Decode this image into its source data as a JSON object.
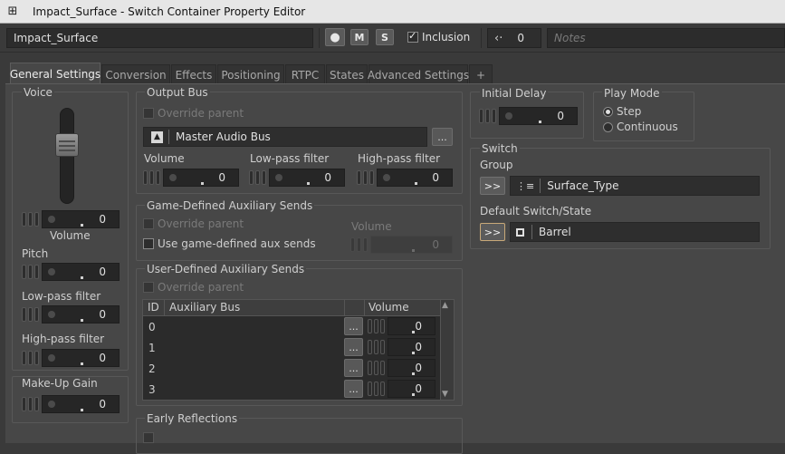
{
  "window": {
    "title": "Impact_Surface - Switch Container Property Editor",
    "icon": "switch-container-icon"
  },
  "toolbar": {
    "name_value": "Impact_Surface",
    "color_icon": "palette-icon",
    "mute_label": "M",
    "solo_label": "S",
    "inclusion_label": "Inclusion",
    "inclusion_checked": true,
    "share_icon": "share-icon",
    "share_count": "0",
    "notes_placeholder": "Notes"
  },
  "tabs": [
    {
      "label": "General Settings",
      "active": true
    },
    {
      "label": "Conversion"
    },
    {
      "label": "Effects"
    },
    {
      "label": "Positioning"
    },
    {
      "label": "RTPC"
    },
    {
      "label": "States"
    },
    {
      "label": "Advanced Settings"
    },
    {
      "label": "+"
    }
  ],
  "voice": {
    "title": "Voice",
    "volume_value": "0",
    "volume_label": "Volume",
    "pitch_label": "Pitch",
    "pitch_value": "0",
    "lpf_label": "Low-pass filter",
    "lpf_value": "0",
    "hpf_label": "High-pass filter",
    "hpf_value": "0"
  },
  "makeup": {
    "title": "Make-Up Gain",
    "value": "0"
  },
  "output_bus": {
    "title": "Output Bus",
    "override_label": "Override parent",
    "bus_icon": "output-bus-icon",
    "bus_name": "Master Audio Bus",
    "browse_label": "...",
    "volume_label": "Volume",
    "volume_value": "0",
    "lpf_label": "Low-pass filter",
    "lpf_value": "0",
    "hpf_label": "High-pass filter",
    "hpf_value": "0"
  },
  "game_aux": {
    "title": "Game-Defined Auxiliary Sends",
    "override_label": "Override parent",
    "use_label": "Use game-defined aux sends",
    "volume_label": "Volume",
    "volume_value": "0"
  },
  "user_aux": {
    "title": "User-Defined Auxiliary Sends",
    "override_label": "Override parent",
    "headers": {
      "id": "ID",
      "bus": "Auxiliary Bus",
      "volume": "Volume"
    },
    "rows": [
      {
        "id": "0",
        "bus": "",
        "volume": "0"
      },
      {
        "id": "1",
        "bus": "",
        "volume": "0"
      },
      {
        "id": "2",
        "bus": "",
        "volume": "0"
      },
      {
        "id": "3",
        "bus": "",
        "volume": "0"
      }
    ],
    "browse_label": "..."
  },
  "early_reflections": {
    "title": "Early Reflections"
  },
  "initial_delay": {
    "title": "Initial Delay",
    "value": "0"
  },
  "play_mode": {
    "title": "Play Mode",
    "options": [
      "Step",
      "Continuous"
    ],
    "selected": "Step"
  },
  "switch": {
    "title": "Switch",
    "group_label": "Group",
    "group_button": ">>",
    "group_value": "Surface_Type",
    "default_label": "Default Switch/State",
    "default_button": ">>",
    "default_value": "Barrel"
  }
}
